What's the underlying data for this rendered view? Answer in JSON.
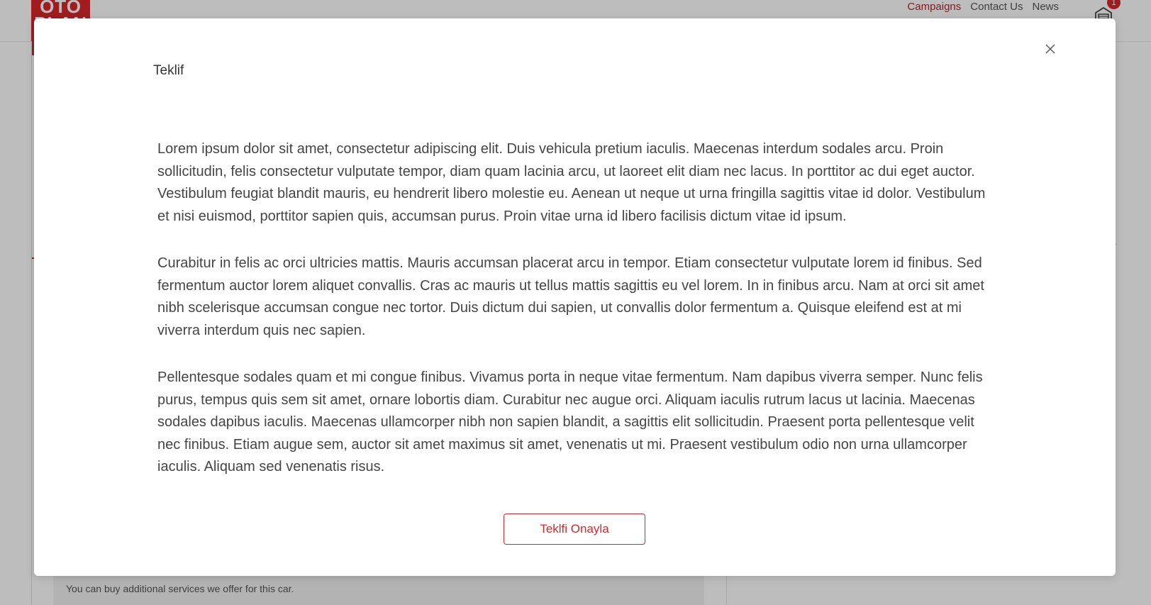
{
  "header": {
    "logo_line1": "OTO",
    "logo_line2": "PLAN",
    "nav": [
      {
        "label": "Campaigns",
        "active": true
      },
      {
        "label": "Contact Us",
        "active": false
      },
      {
        "label": "News",
        "active": false
      }
    ],
    "cart_count": "1"
  },
  "background": {
    "services_text": "You can buy additional services we offer for this car."
  },
  "modal": {
    "title": "Teklif",
    "paragraphs": [
      "Lorem ipsum dolor sit amet, consectetur adipiscing elit. Duis vehicula pretium iaculis. Maecenas interdum sodales arcu. Proin sollicitudin, felis consectetur vulputate tempor, diam quam lacinia arcu, ut laoreet elit diam nec lacus. In porttitor ac dui eget auctor. Vestibulum feugiat blandit mauris, eu hendrerit libero molestie eu. Aenean ut neque ut urna fringilla sagittis vitae id dolor. Vestibulum et nisi euismod, porttitor sapien quis, accumsan purus. Proin vitae urna id libero facilisis dictum vitae id ipsum.",
      "Curabitur in felis ac orci ultricies mattis. Mauris accumsan placerat arcu in tempor. Etiam consectetur vulputate lorem id finibus. Sed fermentum auctor lorem aliquet convallis. Cras ac mauris ut tellus mattis sagittis eu vel lorem. In in finibus arcu. Nam at orci sit amet nibh scelerisque accumsan congue nec tortor. Duis dictum dui sapien, ut convallis dolor fermentum a. Quisque eleifend est at mi viverra interdum quis nec sapien.",
      "Pellentesque sodales quam et mi congue finibus. Vivamus porta in neque vitae fermentum. Nam dapibus viverra semper. Nunc felis purus, tempus quis sem sit amet, ornare lobortis diam. Curabitur nec augue orci. Aliquam iaculis rutrum lacus ut lacinia. Maecenas sodales dapibus iaculis. Maecenas ullamcorper nibh non sapien blandit, a sagittis elit sollicitudin. Praesent porta pellentesque velit nec finibus. Etiam augue sem, auctor sit amet maximus sit amet, venenatis ut mi. Praesent vestibulum odio non urna ullamcorper iaculis. Aliquam sed venenatis risus."
    ],
    "confirm_label": "Teklfi Onayla",
    "close_icon": "close-icon"
  },
  "colors": {
    "brand_red": "#d8262b",
    "nav_active": "#b7262b",
    "text": "#454545"
  }
}
